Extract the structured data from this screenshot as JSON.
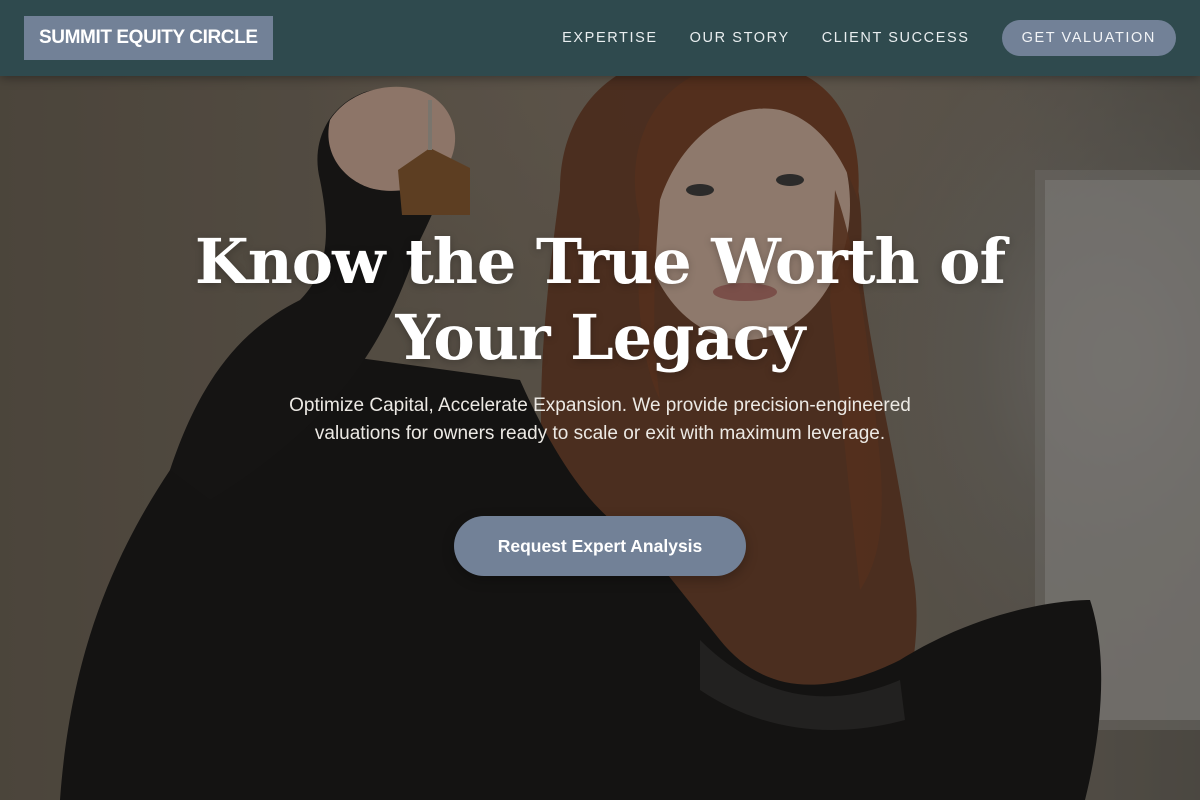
{
  "header": {
    "logo": "SUMMIT EQUITY CIRCLE",
    "nav": [
      "EXPERTISE",
      "OUR STORY",
      "CLIENT SUCCESS"
    ],
    "cta": "GET VALUATION"
  },
  "hero": {
    "headline": "Know the True Worth of Your Legacy",
    "subtext": "Optimize Capital, Accelerate Expansion. We provide precision-engineered valuations for owners ready to scale or exit with maximum leverage.",
    "cta": "Request Expert Analysis"
  },
  "colors": {
    "navbar": "#2f4a4e",
    "accent": "#728197",
    "text_light": "#ffffff"
  }
}
